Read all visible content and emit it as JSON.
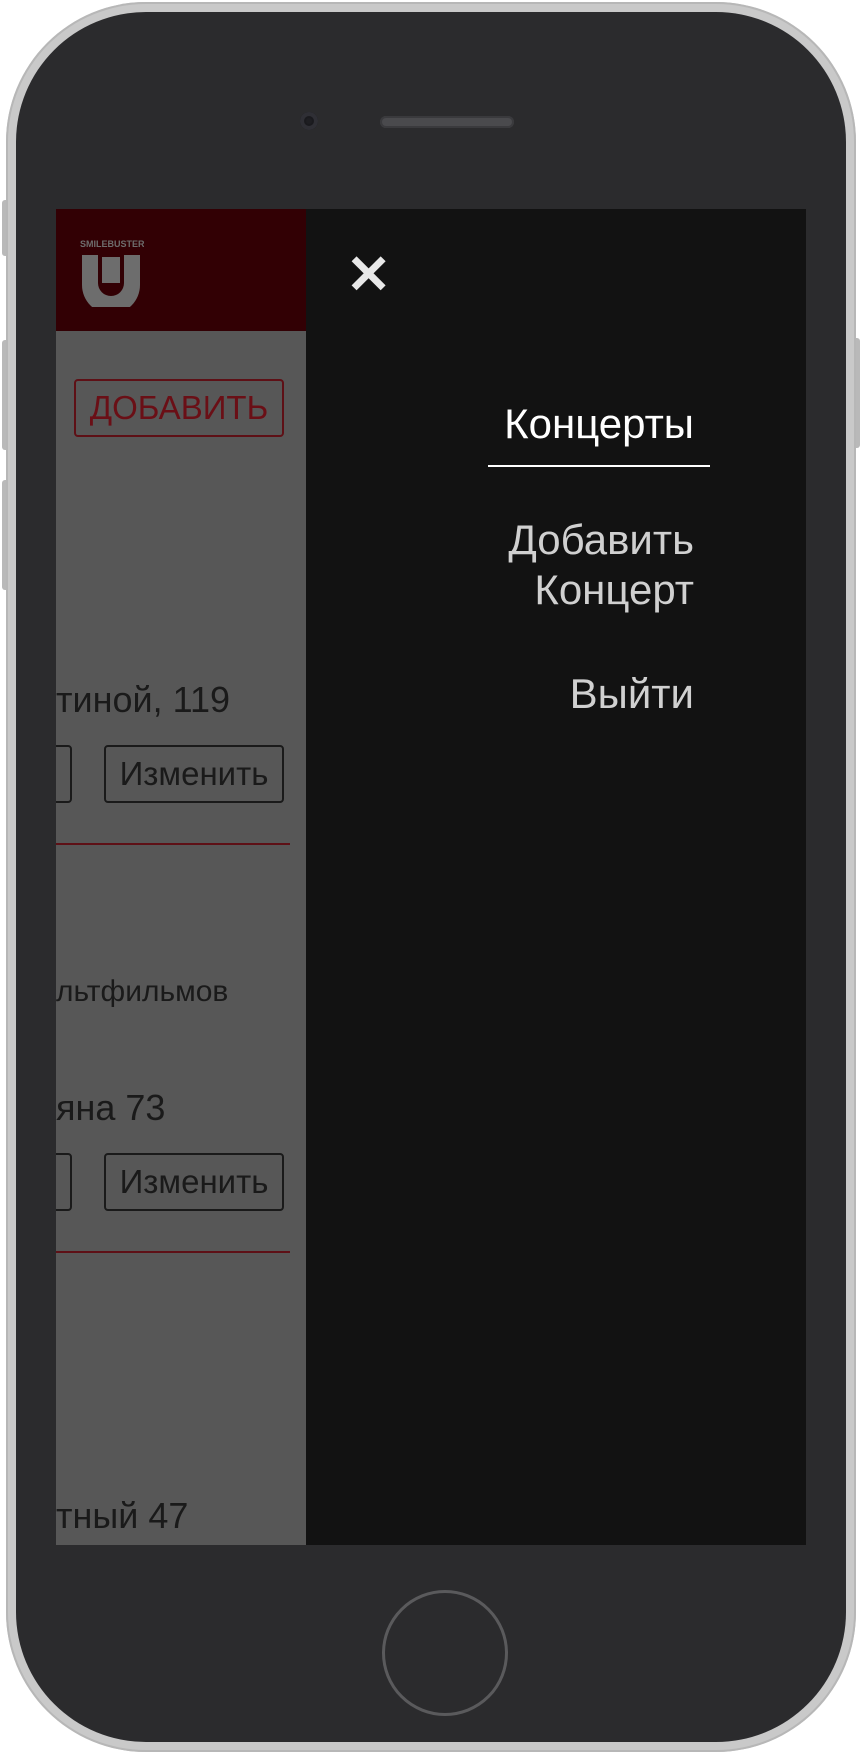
{
  "app": {
    "add_button_label": "ДОБАВИТЬ",
    "logo_text": "SMILEBUSTERS"
  },
  "cards": [
    {
      "line": "тиной, 119",
      "edit_label": "Изменить"
    },
    {
      "line1": "льтфильмов",
      "line2": "яна 73",
      "edit_label": "Изменить"
    },
    {
      "line": "тный 47"
    }
  ],
  "drawer": {
    "close_label": "✕",
    "items": [
      {
        "label": "Концерты",
        "active": true
      },
      {
        "label": "Добавить Концерт",
        "line1": "Добавить",
        "line2": "Концерт"
      },
      {
        "label": "Выйти"
      }
    ]
  },
  "colors": {
    "header_bg": "#320004",
    "accent": "#5e1016",
    "drawer_bg": "#121212",
    "overlay_bg": "#575757"
  }
}
